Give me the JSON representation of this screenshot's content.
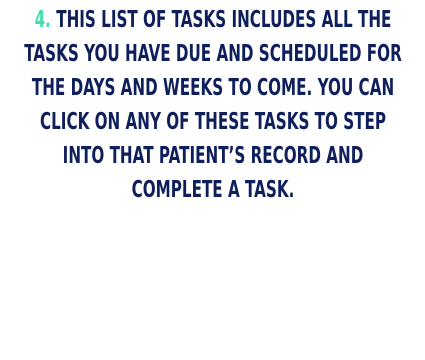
{
  "tip": {
    "step_number": "4.",
    "lines": [
      "THIS LIST OF TASKS INCLUDES ALL THE",
      "TASKS YOU HAVE DUE AND SCHEDULED FOR",
      "THE DAYS AND WEEKS TO COME. YOU CAN",
      "CLICK ON ANY OF THESE TASKS TO STEP",
      "INTO THAT PATIENT’S RECORD AND",
      "COMPLETE A TASK."
    ]
  },
  "colors": {
    "text": "#0f1f5c",
    "step_number": "#3fe0b0",
    "background": "#ffffff"
  }
}
